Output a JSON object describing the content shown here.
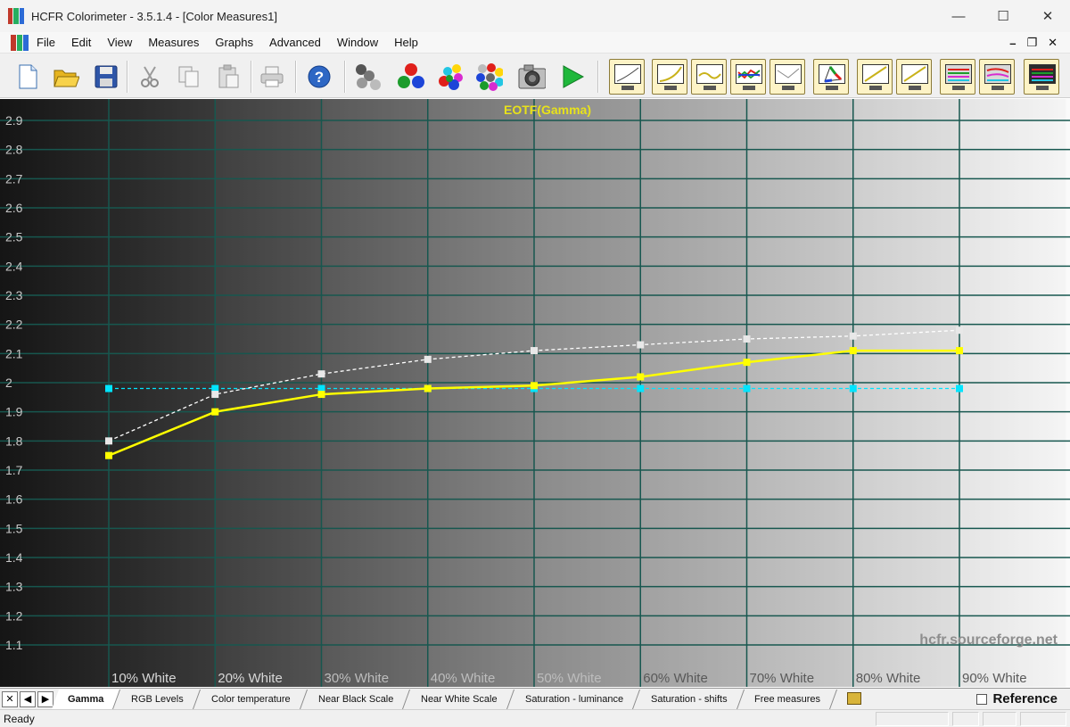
{
  "window": {
    "title": "HCFR Colorimeter - 3.5.1.4 - [Color Measures1]",
    "minimize": "—",
    "maximize": "☐",
    "close": "✕"
  },
  "menu": {
    "items": [
      "File",
      "Edit",
      "View",
      "Measures",
      "Graphs",
      "Advanced",
      "Window",
      "Help"
    ],
    "mdi_minimize": "–",
    "mdi_restore": "❐",
    "mdi_close": "✕"
  },
  "toolbar": {
    "left_icons": [
      "new-document-icon",
      "open-folder-icon",
      "save-icon",
      "cut-icon",
      "copy-icon",
      "paste-icon",
      "print-icon",
      "help-icon",
      "measure-grayscale-icon",
      "measure-primaries-icon",
      "measure-secondaries-icon",
      "measure-all-icon",
      "camera-icon",
      "play-icon"
    ],
    "graph_icons": [
      "gamma-graph-icon",
      "luminance-graph-icon",
      "rgb-graph-icon",
      "color-temp-graph-icon",
      "near-black-graph-icon",
      "cie-chart-icon",
      "near-white-graph-icon",
      "saturation-graph-icon",
      "saturation-luminance-graph-icon",
      "saturation-shifts-graph-icon",
      "measures-grid-icon"
    ]
  },
  "chart_data": {
    "type": "line",
    "title": "EOTF(Gamma)",
    "watermark": "hcfr.sourceforge.net",
    "categories": [
      "10% White",
      "20% White",
      "30% White",
      "40% White",
      "50% White",
      "60% White",
      "70% White",
      "80% White",
      "90% White"
    ],
    "ylim": [
      1.0,
      3.0
    ],
    "yticks": [
      "1.1",
      "1.2",
      "1.3",
      "1.4",
      "1.5",
      "1.6",
      "1.7",
      "1.8",
      "1.9",
      "2",
      "2.1",
      "2.2",
      "2.3",
      "2.4",
      "2.5",
      "2.6",
      "2.7",
      "2.8",
      "2.9"
    ],
    "series": [
      {
        "color": "#ffff00",
        "style": "solid",
        "values": [
          1.75,
          1.9,
          1.96,
          1.98,
          1.99,
          2.02,
          2.07,
          2.11,
          2.11
        ]
      },
      {
        "color": "#ffffff",
        "style": "dashed",
        "values": [
          1.8,
          1.96,
          2.03,
          2.08,
          2.11,
          2.13,
          2.15,
          2.16,
          2.18
        ]
      },
      {
        "color": "#00e5ff",
        "style": "dashed",
        "values": [
          1.98,
          1.98,
          1.98,
          1.98,
          1.98,
          1.98,
          1.98,
          1.98,
          1.98
        ]
      }
    ],
    "grid": true,
    "grid_color": "#17574f",
    "background": "gradient dark-to-light"
  },
  "tabs": {
    "nav": [
      "✕",
      "◀",
      "▶"
    ],
    "items": [
      "Gamma",
      "RGB Levels",
      "Color temperature",
      "Near Black Scale",
      "Near White Scale",
      "Saturation - luminance",
      "Saturation - shifts",
      "Free measures"
    ],
    "active": "Gamma",
    "reference_label": "Reference"
  },
  "status": {
    "text": "Ready"
  }
}
